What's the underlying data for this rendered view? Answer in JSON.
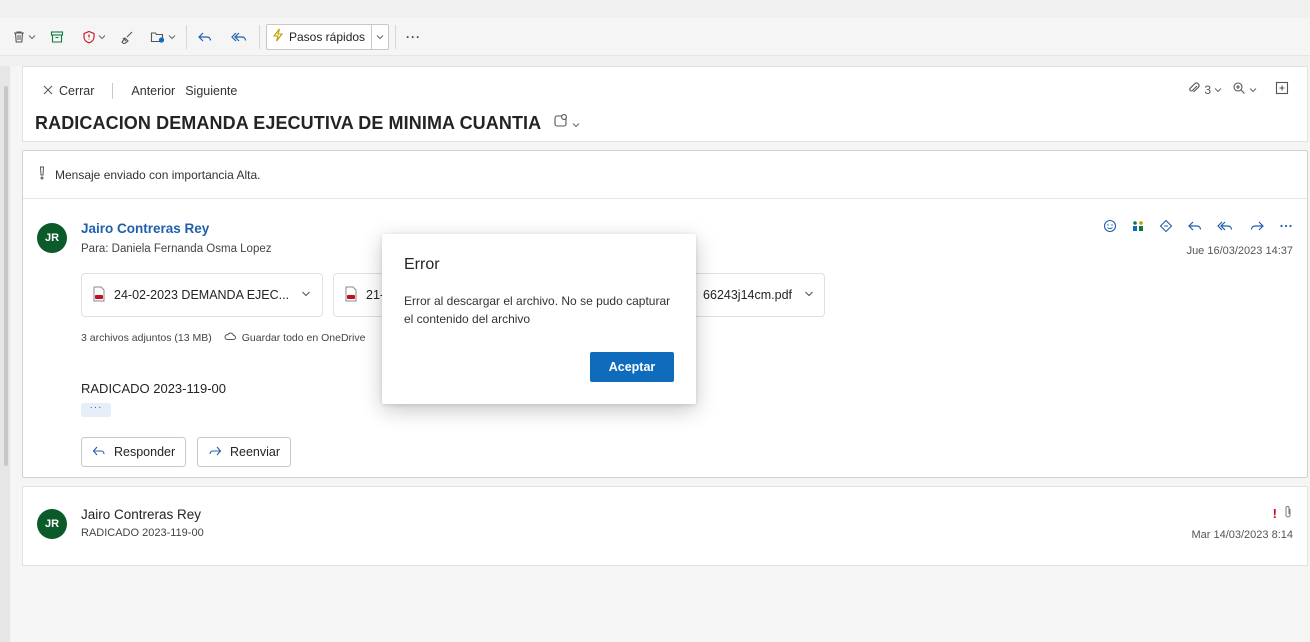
{
  "toolbar": {
    "quick_steps_label": "Pasos rápidos",
    "more_label": "···"
  },
  "reading_header": {
    "close_label": "Cerrar",
    "previous_label": "Anterior",
    "next_label": "Siguiente",
    "attachment_count": "3",
    "subject": "RADICACION DEMANDA EJECUTIVA DE MINIMA CUANTIA"
  },
  "message": {
    "importance_notice": "Mensaje enviado con importancia Alta.",
    "avatar_initials": "JR",
    "sender": "Jairo Contreras Rey",
    "to_line": "Para: Daniela Fernanda Osma Lopez",
    "date": "Jue 16/03/2023 14:37",
    "attachments": [
      {
        "name": "24-02-2023 DEMANDA EJEC..."
      },
      {
        "name": "21-"
      },
      {
        "name": "66243j14cm.pdf"
      }
    ],
    "attachments_summary": "3 archivos adjuntos (13 MB)",
    "save_onedrive_label": "Guardar todo en OneDrive",
    "body": "RADICADO 2023-119-00",
    "show_more": "···",
    "reply_label": "Responder",
    "forward_label": "Reenviar"
  },
  "message2": {
    "avatar_initials": "JR",
    "sender": "Jairo Contreras Rey",
    "preview": "RADICADO 2023-119-00",
    "importance_mark": "!",
    "date": "Mar 14/03/2023 8:14"
  },
  "dialog": {
    "title": "Error",
    "message": "Error al descargar el archivo. No se pudo capturar el contenido del archivo",
    "ok_label": "Aceptar"
  },
  "colors": {
    "accent": "#0f6cbd",
    "link": "#1f5fae",
    "avatar_bg": "#0b5a2a",
    "importance": "#c50f1f",
    "block_icon": "#c50f1f"
  },
  "icons": {
    "toolbar": [
      "delete-icon",
      "archive-icon",
      "report-icon",
      "sweep-icon",
      "move-icon",
      "reply-icon",
      "reply-all-icon",
      "quick-steps-icon"
    ],
    "header": [
      "attachment-icon",
      "zoom-icon",
      "expand-icon"
    ],
    "message_actions": [
      "emoji-icon",
      "teams-icon",
      "sticker-icon",
      "reply-icon",
      "reply-all-icon",
      "forward-icon",
      "more-icon"
    ]
  }
}
